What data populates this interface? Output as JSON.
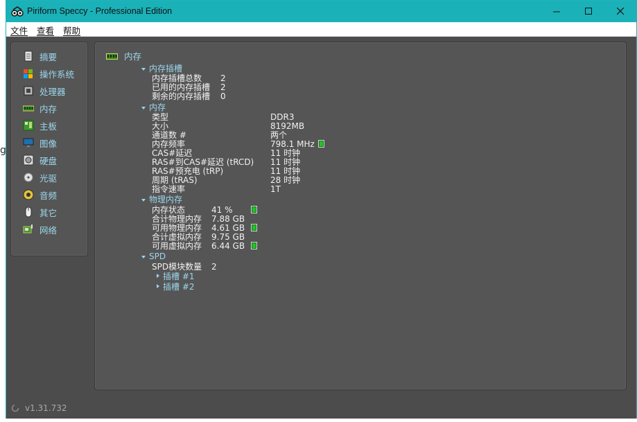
{
  "window": {
    "title": "Piriform Speccy - Professional Edition",
    "accent_color": "#1bb1b8"
  },
  "menu": {
    "items": [
      {
        "label": "文件"
      },
      {
        "label": "查看"
      },
      {
        "label": "帮助"
      }
    ]
  },
  "sidebar": {
    "items": [
      {
        "label": "摘要",
        "icon": "summary-icon"
      },
      {
        "label": "操作系统",
        "icon": "windows-icon"
      },
      {
        "label": "处理器",
        "icon": "cpu-icon"
      },
      {
        "label": "内存",
        "icon": "ram-icon"
      },
      {
        "label": "主板",
        "icon": "motherboard-icon"
      },
      {
        "label": "图像",
        "icon": "monitor-icon"
      },
      {
        "label": "硬盘",
        "icon": "hdd-icon"
      },
      {
        "label": "光驱",
        "icon": "optical-drive-icon"
      },
      {
        "label": "音频",
        "icon": "speaker-icon"
      },
      {
        "label": "其它",
        "icon": "mouse-icon"
      },
      {
        "label": "网络",
        "icon": "network-icon"
      }
    ]
  },
  "main": {
    "title": "内存",
    "slots": {
      "heading": "内存插槽",
      "rows": [
        {
          "label": "内存插槽总数",
          "value": "2"
        },
        {
          "label": "已用的内存插槽",
          "value": "2"
        },
        {
          "label": "剩余的内存插槽",
          "value": "0"
        }
      ]
    },
    "memory": {
      "heading": "内存",
      "rows": [
        {
          "label": "类型",
          "value": "DDR3"
        },
        {
          "label": "大小",
          "value": "8192MB"
        },
        {
          "label": "通道数 #",
          "value": "两个"
        },
        {
          "label": "内存频率",
          "value": "798.1 MHz"
        },
        {
          "label": "CAS#延迟",
          "value": "11 时钟"
        },
        {
          "label": "RAS#到CAS#延迟 (tRCD)",
          "value": "11 时钟"
        },
        {
          "label": "RAS#预充电 (tRP)",
          "value": "11 时钟"
        },
        {
          "label": "周期 (tRAS)",
          "value": "28 时钟"
        },
        {
          "label": "指令速率",
          "value": "1T"
        }
      ]
    },
    "physical": {
      "heading": "物理内存",
      "rows": [
        {
          "label": "内存状态",
          "value": "41 %"
        },
        {
          "label": "合计物理内存",
          "value": "7.88 GB"
        },
        {
          "label": "可用物理内存",
          "value": "4.61 GB"
        },
        {
          "label": "合计虚拟内存",
          "value": "9.75 GB"
        },
        {
          "label": "可用虚拟内存",
          "value": "6.44 GB"
        }
      ]
    },
    "spd": {
      "heading": "SPD",
      "count_label": "SPD模块数量",
      "count_value": "2",
      "slot_items": [
        {
          "label": "插槽 #1"
        },
        {
          "label": "插槽 #2"
        }
      ]
    }
  },
  "status": {
    "version": "v1.31.732"
  },
  "ghost_text": "g"
}
